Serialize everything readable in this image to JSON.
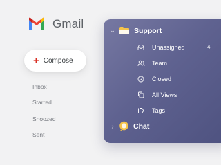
{
  "app": {
    "name": "Gmail"
  },
  "compose": {
    "label": "Compose"
  },
  "nav": [
    {
      "label": "Inbox"
    },
    {
      "label": "Starred"
    },
    {
      "label": "Snoozed"
    },
    {
      "label": "Sent"
    }
  ],
  "panel": {
    "folders": [
      {
        "label": "Support",
        "expanded": true,
        "items": [
          {
            "label": "Unassigned",
            "count": "4",
            "icon": "inbox-icon"
          },
          {
            "label": "Team",
            "icon": "team-icon"
          },
          {
            "label": "Closed",
            "icon": "check-circle-icon"
          },
          {
            "label": "All Views",
            "icon": "copy-icon"
          },
          {
            "label": "Tags",
            "icon": "tag-icon"
          }
        ]
      },
      {
        "label": "Chat",
        "expanded": false
      }
    ]
  },
  "colors": {
    "gmail_red": "#ea4335",
    "panel_start": "#7678a2",
    "panel_end": "#4e5280",
    "folder_yellow": "#f6c44a"
  }
}
